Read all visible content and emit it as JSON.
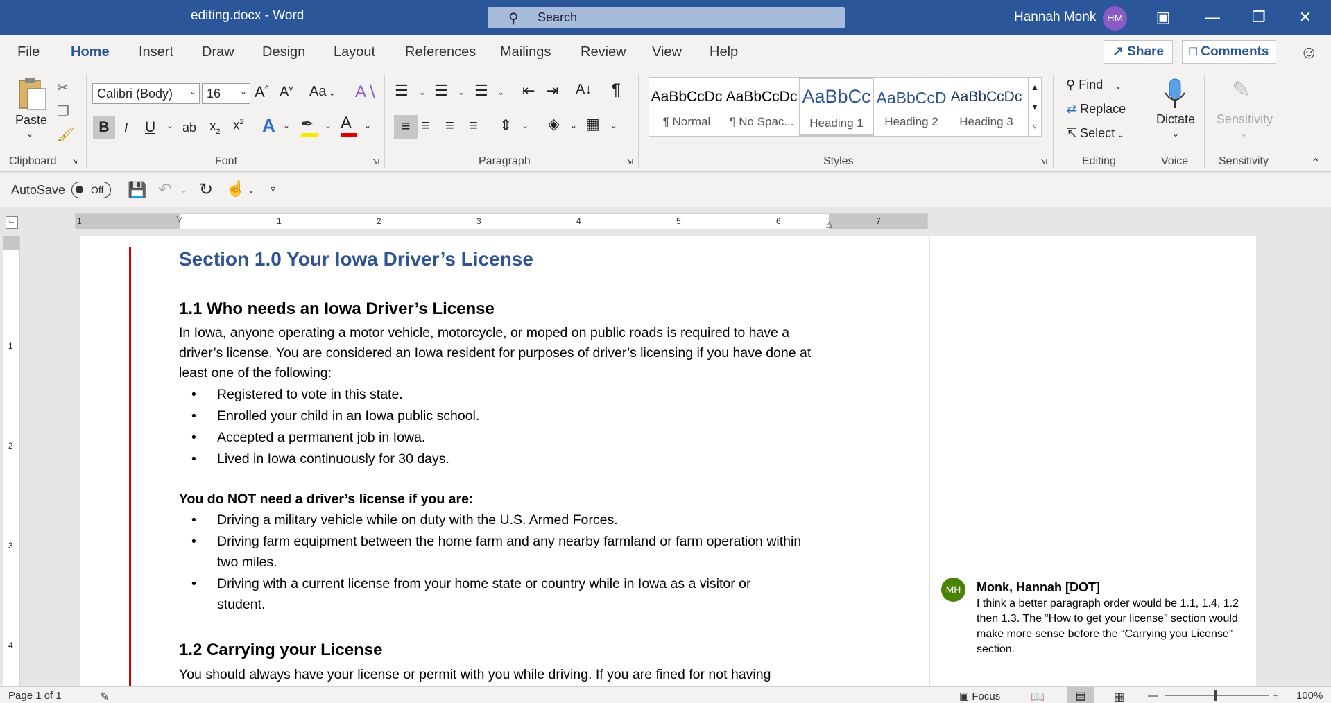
{
  "titlebar": {
    "title": "editing.docx  -  Word",
    "search_placeholder": "Search",
    "user_name": "Hannah Monk",
    "user_initials": "HM"
  },
  "tabs": [
    "File",
    "Home",
    "Insert",
    "Draw",
    "Design",
    "Layout",
    "References",
    "Mailings",
    "Review",
    "View",
    "Help"
  ],
  "active_tab": "Home",
  "share_label": "Share",
  "comments_label": "Comments",
  "ribbon": {
    "clipboard": {
      "paste": "Paste",
      "label": "Clipboard"
    },
    "font": {
      "family": "Calibri (Body)",
      "size": "16",
      "change_case": "Aa",
      "label": "Font"
    },
    "paragraph": {
      "label": "Paragraph"
    },
    "styles": {
      "label": "Styles",
      "items": [
        {
          "preview": "AaBbCcDc",
          "name": "¶ Normal"
        },
        {
          "preview": "AaBbCcDc",
          "name": "¶ No Spac..."
        },
        {
          "preview": "AaBbCc",
          "name": "Heading 1"
        },
        {
          "preview": "AaBbCcD",
          "name": "Heading 2"
        },
        {
          "preview": "AaBbCcDc",
          "name": "Heading 3"
        }
      ]
    },
    "editing": {
      "find": "Find",
      "replace": "Replace",
      "select": "Select",
      "label": "Editing"
    },
    "voice": {
      "dictate": "Dictate",
      "label": "Voice"
    },
    "sensitivity": {
      "button": "Sensitivity",
      "label": "Sensitivity"
    }
  },
  "qat": {
    "autosave": "AutoSave",
    "toggle": "Off"
  },
  "ruler": {
    "numbers": [
      "1",
      "1",
      "2",
      "3",
      "4",
      "5",
      "6",
      "7"
    ],
    "vnumbers": [
      "1",
      "2",
      "3",
      "4"
    ]
  },
  "document": {
    "heading1": "Section 1.0 Your Iowa Driver’s License",
    "s11_heading": "1.1 Who needs an Iowa Driver’s License",
    "s11_para": "In Iowa, anyone operating a motor vehicle, motorcycle, or moped on public roads is required to have a driver’s license. You are considered an Iowa resident for purposes of driver’s licensing if you have done at least one of the following:",
    "s11_bullets": [
      "Registered to vote in this state.",
      "Enrolled your child in an Iowa public school.",
      "Accepted a permanent job in Iowa.",
      "Lived in Iowa continuously for 30 days."
    ],
    "not_need_heading": "You do NOT need a driver’s license if you are:",
    "not_need_bullets": [
      "Driving a military vehicle while on duty with the U.S. Armed Forces.",
      "Driving farm equipment between the home farm and any nearby farmland or farm operation within two miles.",
      "Driving with a current license from your home state or country while in Iowa as a visitor or student."
    ],
    "s12_heading": "1.2 Carrying your License",
    "s12_para": "You should always have your license or permit with you while driving. If you are fined for not having"
  },
  "comment": {
    "initials": "MH",
    "author": "Monk, Hannah [DOT]",
    "text": "I think a better paragraph order would be 1.1, 1.4, 1.2 then 1.3. The “How to get your license” section would make more sense before the “Carrying you License” section."
  },
  "status": {
    "page": "Page 1 of 1",
    "focus": "Focus",
    "zoom": "100%"
  },
  "colors": {
    "brand": "#2b579a",
    "heading": "#2f5496",
    "change_bar": "#d40000",
    "comment_avatar": "#498205",
    "user_avatar": "#8a5bc4"
  }
}
